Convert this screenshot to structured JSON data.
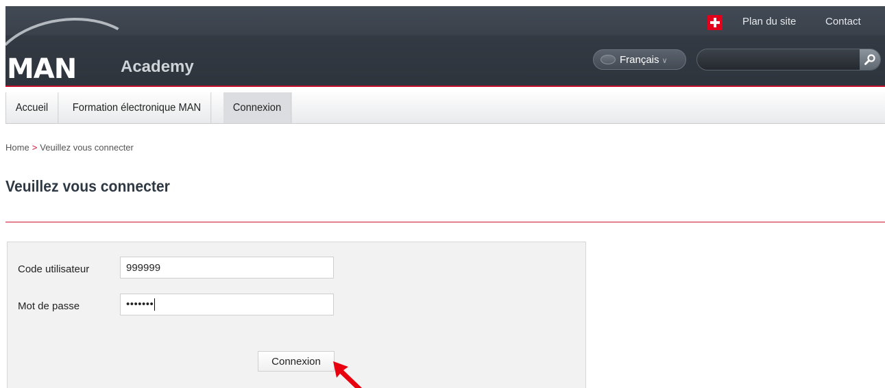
{
  "header": {
    "logo_text": "MAN",
    "site_name": "Academy",
    "top_links": [
      "Plan du site",
      "Contact"
    ],
    "language": "Français",
    "search": {
      "value": "",
      "placeholder": ""
    },
    "icons": {
      "flag": "swiss-flag-icon",
      "search": "search-icon",
      "language": "globe-icon"
    },
    "colors": {
      "header": "#353b44",
      "accent": "#c8102e"
    }
  },
  "nav": {
    "items": [
      {
        "label": "Accueil",
        "active": false
      },
      {
        "label": "Formation électronique MAN",
        "active": false
      },
      {
        "label": "Connexion",
        "active": true
      }
    ]
  },
  "breadcrumb": {
    "home": "Home",
    "separator": ">",
    "current": "Veuillez vous connecter"
  },
  "page": {
    "title": "Veuillez vous connecter"
  },
  "login": {
    "user_label": "Code utilisateur",
    "user_value": "999999",
    "password_label": "Mot de passe",
    "password_masked": "•••••••",
    "submit_label": "Connexion"
  },
  "annotation": {
    "arrow": "red-pointer-arrow",
    "color": "#e8000f"
  }
}
